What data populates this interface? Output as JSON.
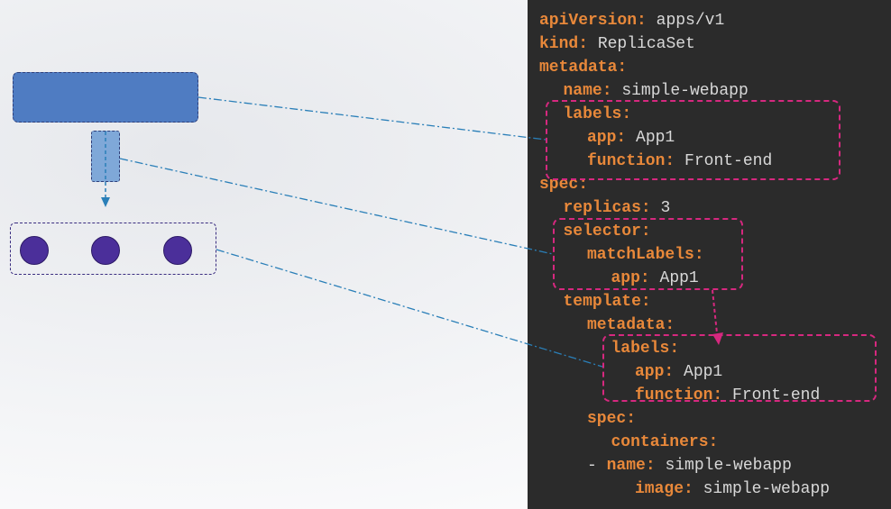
{
  "yaml": {
    "lines": [
      {
        "indent": 0,
        "key": "apiVersion",
        "value": "apps/v1"
      },
      {
        "indent": 0,
        "key": "kind",
        "value": "ReplicaSet"
      },
      {
        "indent": 0,
        "key": "metadata",
        "value": ""
      },
      {
        "indent": 1,
        "key": "name",
        "value": "simple-webapp"
      },
      {
        "indent": 1,
        "key": "labels",
        "value": ""
      },
      {
        "indent": 2,
        "key": "app",
        "value": "App1"
      },
      {
        "indent": 2,
        "key": "function",
        "value": "Front-end"
      },
      {
        "indent": 0,
        "key": "spec",
        "value": ""
      },
      {
        "indent": 1,
        "key": "replicas",
        "value": "3"
      },
      {
        "indent": 1,
        "key": "selector",
        "value": ""
      },
      {
        "indent": 2,
        "key": "matchLabels",
        "value": ""
      },
      {
        "indent": 3,
        "key": "app",
        "value": "App1"
      },
      {
        "indent": 1,
        "key": "template",
        "value": ""
      },
      {
        "indent": 2,
        "key": "metadata",
        "value": ""
      },
      {
        "indent": 3,
        "key": "labels",
        "value": ""
      },
      {
        "indent": 4,
        "key": "app",
        "value": "App1"
      },
      {
        "indent": 4,
        "key": "function",
        "value": "Front-end"
      },
      {
        "indent": 2,
        "key": "spec",
        "value": ""
      },
      {
        "indent": 3,
        "key": "containers",
        "value": ""
      },
      {
        "indent": 3,
        "key": "name",
        "value": "simple-webapp",
        "dash": true
      },
      {
        "indent": 4,
        "key": "image",
        "value": "simple-webapp"
      }
    ]
  },
  "diagram": {
    "pod_count": 3
  },
  "colors": {
    "panel_bg": "#2b2b2b",
    "yaml_key": "#e8883a",
    "yaml_value": "#d8d8d8",
    "highlight": "#d6287f",
    "connector": "#2a7fb8",
    "replicaset_box": "#4f7cc2",
    "selector_box": "#7fa8d8",
    "pod": "#4b2f9a"
  }
}
